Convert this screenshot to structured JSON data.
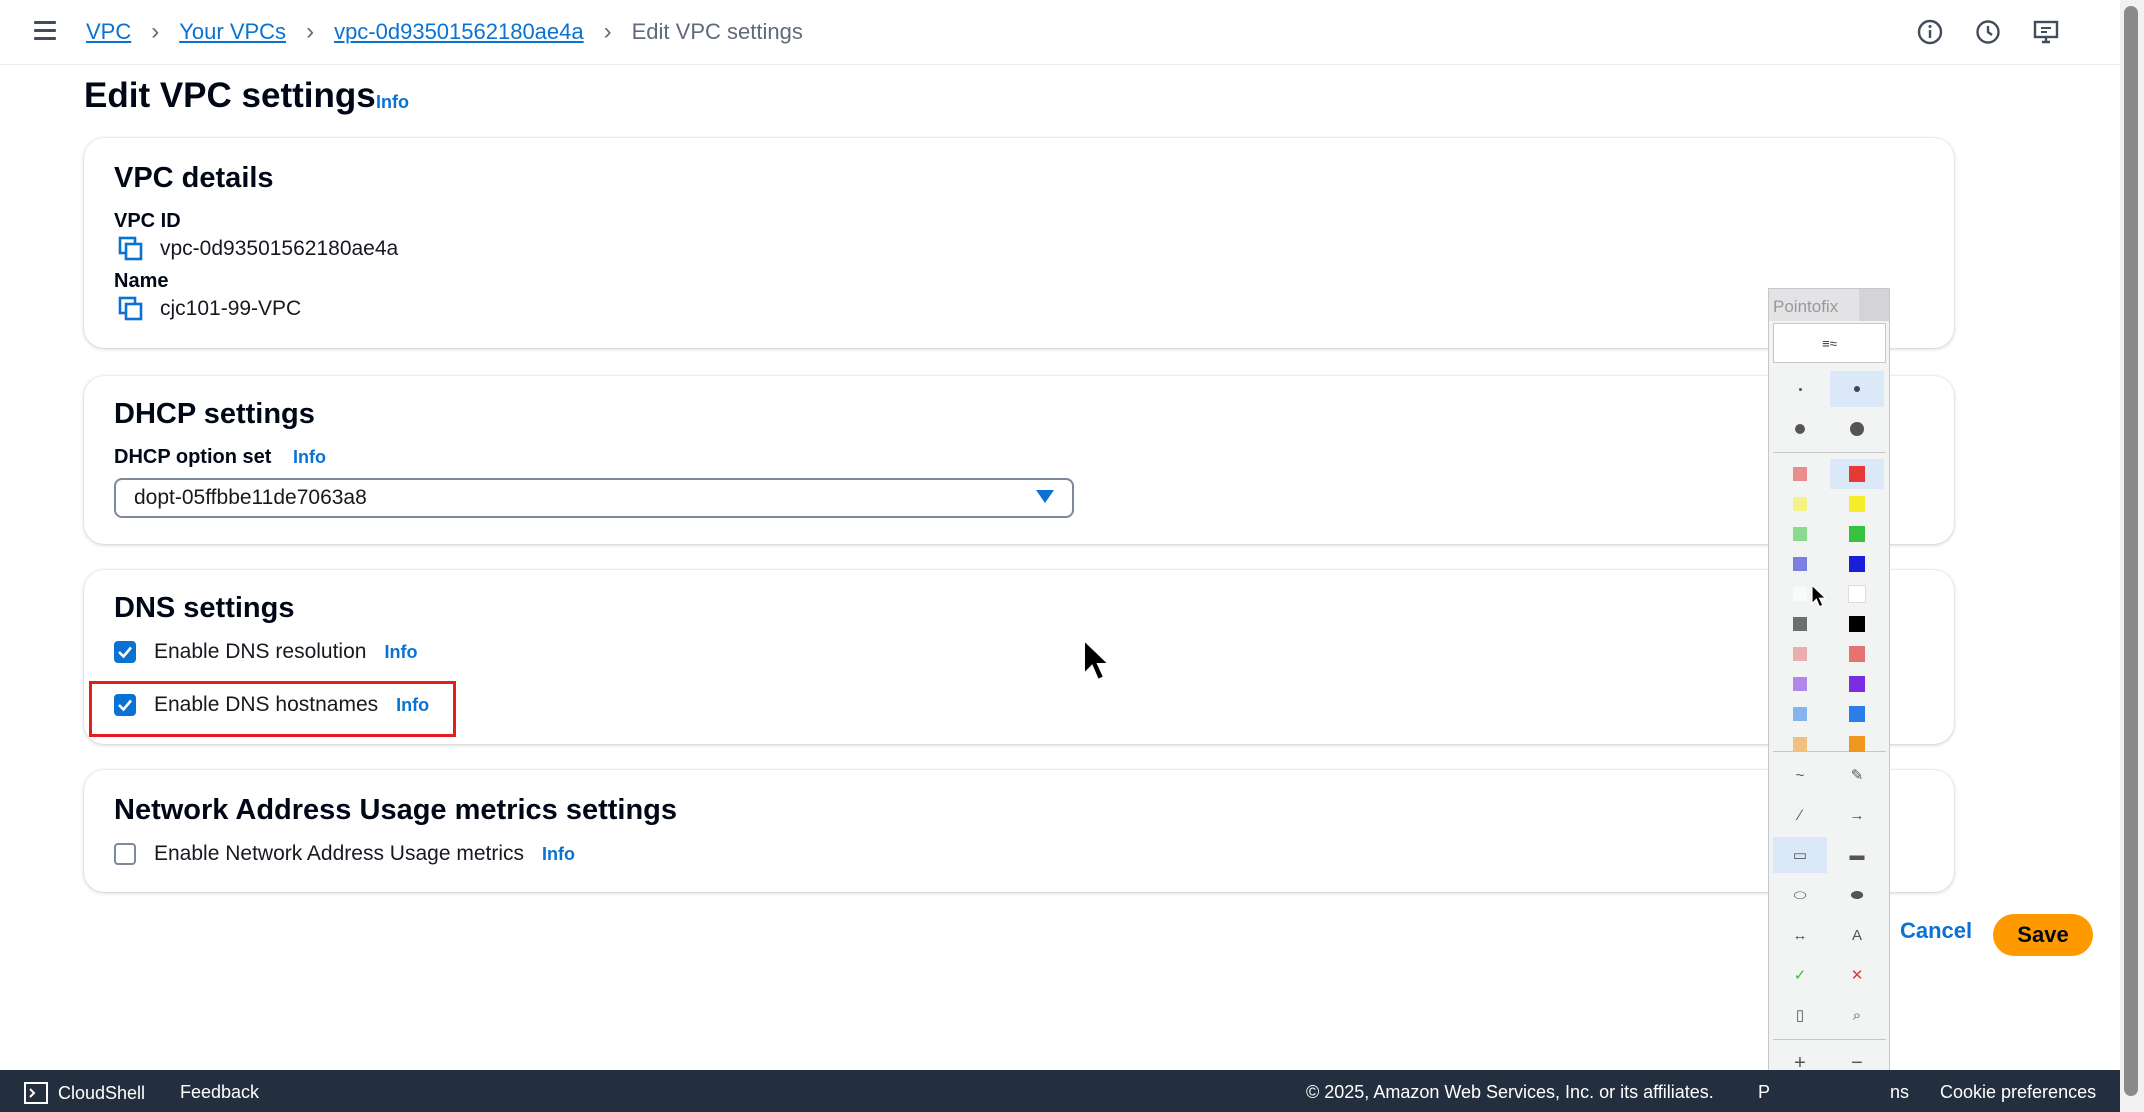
{
  "breadcrumb": {
    "items": [
      "VPC",
      "Your VPCs",
      "vpc-0d93501562180ae4a"
    ],
    "current": "Edit VPC settings"
  },
  "page": {
    "title": "Edit VPC settings",
    "info": "Info"
  },
  "vpc_details": {
    "heading": "VPC details",
    "vpc_id_label": "VPC ID",
    "vpc_id_value": "vpc-0d93501562180ae4a",
    "name_label": "Name",
    "name_value": "cjc101-99-VPC"
  },
  "dhcp": {
    "heading": "DHCP settings",
    "option_label": "DHCP option set",
    "info": "Info",
    "selected": "dopt-05ffbbe11de7063a8"
  },
  "dns": {
    "heading": "DNS settings",
    "resolution_label": "Enable DNS resolution",
    "resolution_checked": true,
    "hostnames_label": "Enable DNS hostnames",
    "hostnames_checked": true,
    "info": "Info"
  },
  "nau": {
    "heading": "Network Address Usage metrics settings",
    "label": "Enable Network Address Usage metrics",
    "checked": false,
    "info": "Info"
  },
  "actions": {
    "cancel": "Cancel",
    "save": "Save"
  },
  "pointofix": {
    "title": "Pointofix",
    "colors": [
      "#e53935",
      "#f5ee2a",
      "#36c23c",
      "#1a1fd6",
      "#ffffff",
      "#000000",
      "#e57373",
      "#7b2ee0",
      "#2b7de9",
      "#f0961f"
    ]
  },
  "footer": {
    "cloudshell": "CloudShell",
    "feedback": "Feedback",
    "copyright": "© 2025, Amazon Web Services, Inc. or its affiliates.",
    "privacy_fragment_left": "P",
    "privacy_fragment_right": "ns",
    "cookies": "Cookie preferences"
  },
  "colors": {
    "accent": "#0972d3",
    "primary_button": "#ff9900",
    "highlight": "#e0201b",
    "footer_bg": "#232f3e"
  }
}
